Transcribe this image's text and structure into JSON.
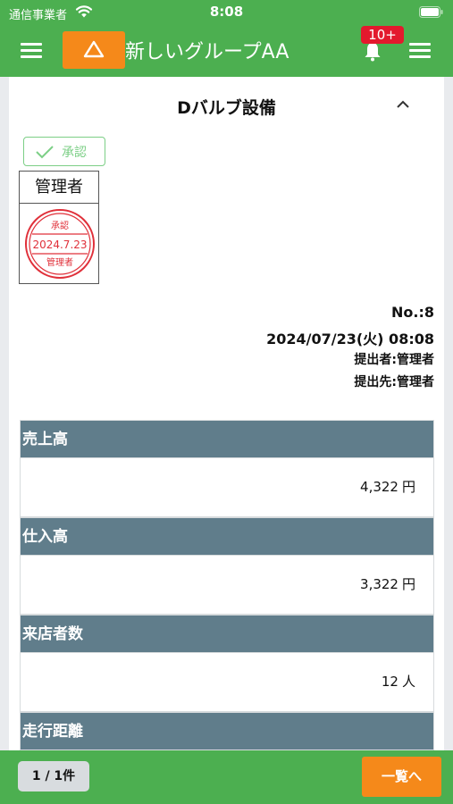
{
  "status_bar": {
    "carrier": "通信事業者",
    "time": "8:08"
  },
  "header": {
    "group_name": "新しいグループAA",
    "notification_count": "10+"
  },
  "card": {
    "title": "Dバルブ設備",
    "approve_label": "承認",
    "approver_role": "管理者",
    "stamp": {
      "top": "承認",
      "date": "2024.7.23",
      "bottom": "管理者",
      "color": "#e0303a"
    },
    "number": "No.:8",
    "datetime": "2024/07/23(火) 08:08",
    "submitter": "提出者:管理者",
    "destination": "提出先:管理者"
  },
  "fields": [
    {
      "label": "売上高",
      "value": "4,322",
      "unit": "円"
    },
    {
      "label": "仕入高",
      "value": "3,322",
      "unit": "円"
    },
    {
      "label": "来店者数",
      "value": "12",
      "unit": "人"
    },
    {
      "label": "走行距離",
      "value": "",
      "unit": ""
    }
  ],
  "footer": {
    "page_count": "1 / 1件",
    "list_button": "一覧へ"
  },
  "colors": {
    "header_green": "#4caf50",
    "accent_orange": "#f5891a",
    "field_header": "#607d8b",
    "badge_red": "#e3192d"
  }
}
